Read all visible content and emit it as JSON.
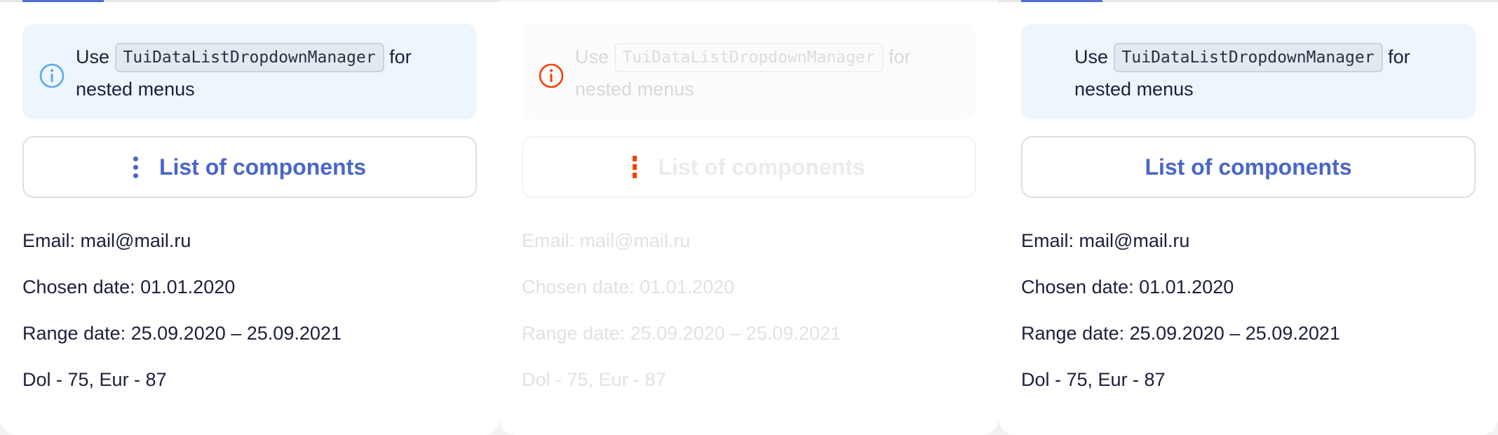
{
  "panels": [
    {
      "notice": {
        "use": "Use",
        "code": "TuiDataListDropdownManager",
        "rest": "for nested menus",
        "icon": "info-icon",
        "icon_color": "#5aa7f0"
      },
      "button": {
        "label": "List of components",
        "icon": "vertical-dots-icon"
      },
      "lines": {
        "email": "Email: mail@mail.ru",
        "date": "Chosen date: 01.01.2020",
        "range": "Range date: 25.09.2020 – 25.09.2021",
        "currency": "Dol - 75, Eur - 87"
      }
    },
    {
      "notice": {
        "use": "Use",
        "code": "TuiDataListDropdownManager",
        "rest": "for nested menus",
        "icon": "info-icon",
        "icon_color": "#ff3c00"
      },
      "button": {
        "label": "List of components",
        "icon": "vertical-dots-icon"
      },
      "lines": {
        "email": "Email: mail@mail.ru",
        "date": "Chosen date: 01.01.2020",
        "range": "Range date: 25.09.2020 – 25.09.2021",
        "currency": "Dol - 75, Eur - 87"
      }
    },
    {
      "notice": {
        "use": "Use",
        "code": "TuiDataListDropdownManager",
        "rest": "for nested menus"
      },
      "button": {
        "label": "List of components"
      },
      "lines": {
        "email": "Email: mail@mail.ru",
        "date": "Chosen date: 01.01.2020",
        "range": "Range date: 25.09.2020 – 25.09.2021",
        "currency": "Dol - 75, Eur - 87"
      }
    }
  ],
  "colors": {
    "accent": "#4a66c7",
    "tab_underline": "#526ed3",
    "notice_bg": "#edf5fd",
    "text": "#1b1f3b",
    "error": "#ff3c00"
  }
}
